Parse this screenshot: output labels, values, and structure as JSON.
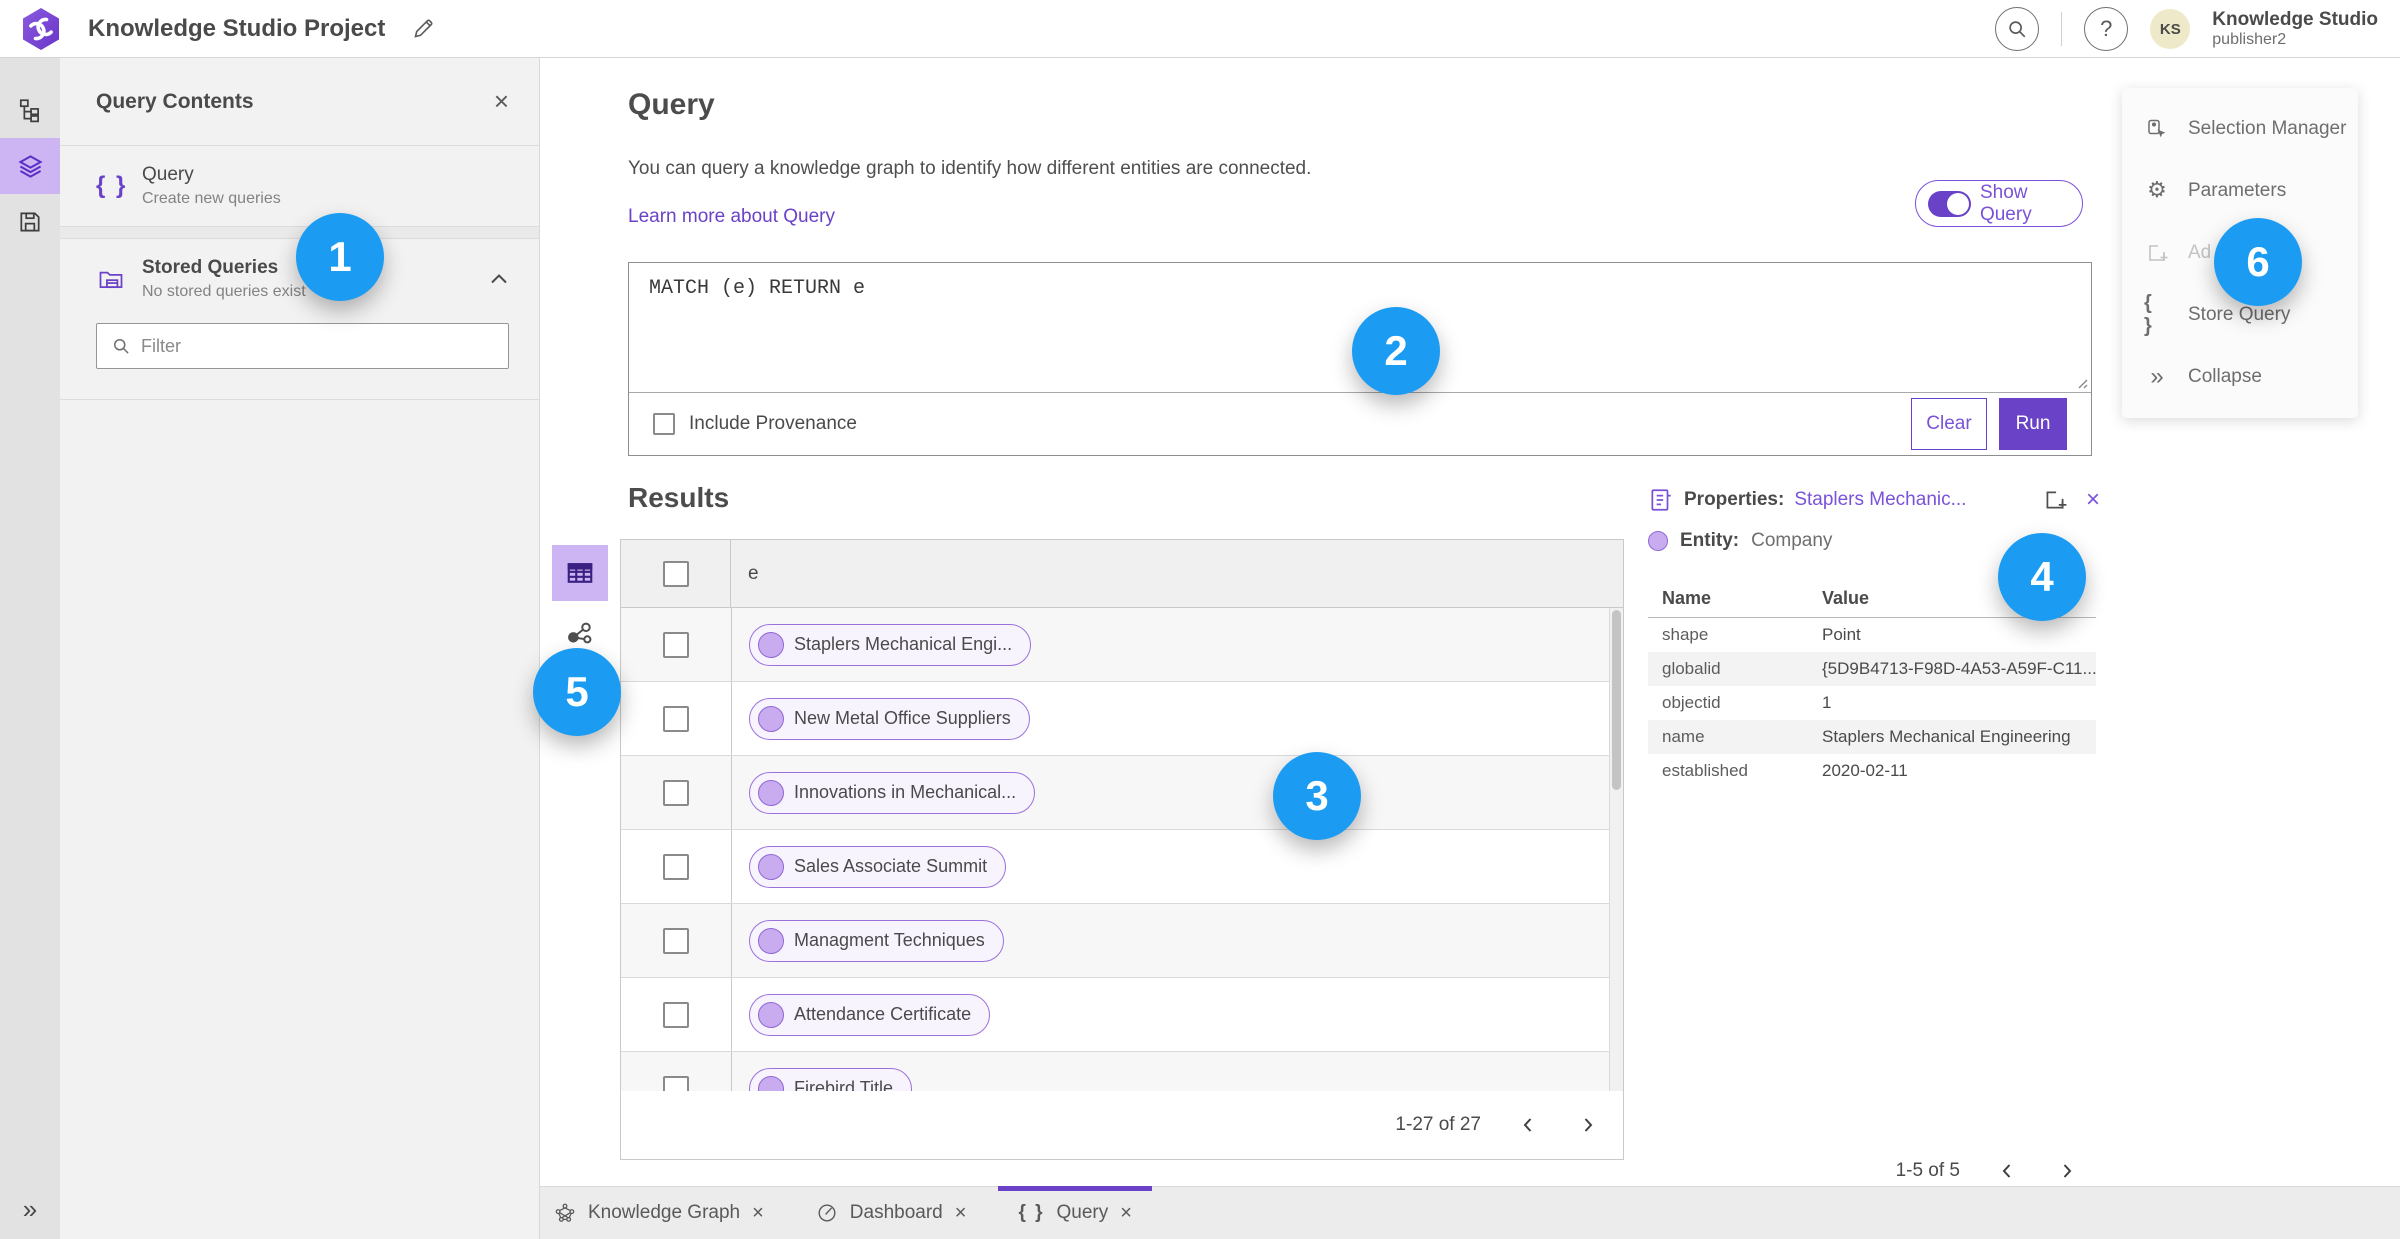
{
  "header": {
    "title": "Knowledge Studio Project",
    "user_name": "Knowledge Studio",
    "user_role": "publisher2",
    "avatar_initials": "KS"
  },
  "contents_panel": {
    "title": "Query Contents",
    "query_item": {
      "title": "Query",
      "subtitle": "Create new queries"
    },
    "stored_queries": {
      "title": "Stored Queries",
      "subtitle": "No stored queries exist"
    },
    "filter_placeholder": "Filter"
  },
  "query_section": {
    "title": "Query",
    "description": "You can query a knowledge graph to identify how different entities are connected.",
    "learn_more": "Learn more about Query",
    "show_query_label": "Show Query",
    "query_text": "MATCH (e) RETURN e",
    "include_provenance_label": "Include Provenance",
    "clear_label": "Clear",
    "run_label": "Run"
  },
  "results": {
    "title": "Results",
    "column_header": "e",
    "rows": [
      "Staplers Mechanical Engi...",
      "New Metal Office Suppliers",
      "Innovations in Mechanical...",
      "Sales Associate Summit",
      "Managment Techniques",
      "Attendance Certificate",
      "Firebird Title"
    ],
    "pagination": "1-27 of 27"
  },
  "properties_panel": {
    "title_label": "Properties:",
    "title_link": "Staplers Mechanic...",
    "entity_label": "Entity:",
    "entity_value": "Company",
    "columns": [
      "Name",
      "Value"
    ],
    "rows": [
      [
        "shape",
        "Point"
      ],
      [
        "globalid",
        "{5D9B4713-F98D-4A53-A59F-C11..."
      ],
      [
        "objectid",
        "1"
      ],
      [
        "name",
        "Staplers Mechanical Engineering"
      ],
      [
        "established",
        "2020-02-11"
      ]
    ],
    "pagination": "1-5 of 5"
  },
  "side_menu": {
    "items": [
      {
        "label": "Selection Manager"
      },
      {
        "label": "Parameters"
      },
      {
        "label": "Ad"
      },
      {
        "label": "Store Query"
      },
      {
        "label": "Collapse"
      }
    ]
  },
  "tabs": [
    {
      "label": "Knowledge Graph"
    },
    {
      "label": "Dashboard"
    },
    {
      "label": "Query"
    }
  ],
  "annotations": [
    {
      "label": "1"
    },
    {
      "label": "2"
    },
    {
      "label": "3"
    },
    {
      "label": "4"
    },
    {
      "label": "5"
    },
    {
      "label": "6"
    }
  ],
  "glyphs": {
    "close": "×",
    "collapse": "»",
    "braces": "{ }",
    "gear": "⚙"
  },
  "colors": {
    "brand_purple": "#6a42c7",
    "light_purple_bg": "#cdb4f2",
    "pill_fill": "#f8f4fe",
    "pill_border": "#9b72dd",
    "annotation_blue": "#1b9cf2",
    "avatar_bg": "#eee9c8"
  }
}
